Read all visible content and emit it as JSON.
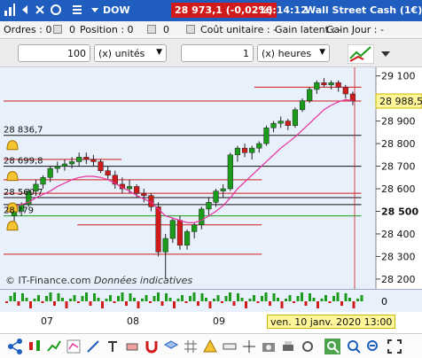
{
  "titlebar": {
    "instrument": "DOW",
    "price_change": "28 973,1 (-0,02%)",
    "time": "16:14:12",
    "market": "Wall Street Cash (1€)"
  },
  "orders": {
    "orders_label": "Ordres : 0",
    "orders_count": "0",
    "position_label": "Position : 0",
    "position_count": "0",
    "unit_cost_label": "Coût unitaire : -",
    "latent_gain_label": "Gain latent : -",
    "day_gain_label": "Gain Jour : -"
  },
  "inputs": {
    "quantity": "100",
    "quantity_unit": "(x) unités",
    "period": "1",
    "period_unit": "(x) heures"
  },
  "chart_data": {
    "type": "candlestick",
    "y_ticks": [
      "29 100",
      "29 000",
      "28 900",
      "28 800",
      "28 700",
      "28 600",
      "28 500",
      "28 400",
      "28 300",
      "28 200"
    ],
    "ylim": [
      28180,
      29130
    ],
    "current_price_label": "28 988,5",
    "bold_tick": "28 500",
    "level_labels": [
      "28 836,7",
      "28 699,8",
      "28 560,7",
      "28 ?79"
    ],
    "x_labels": [
      "07",
      "08",
      "09",
      "10"
    ],
    "cursor_date": "ven. 10 janv. 2020 13:00",
    "watermark": "© IT-Finance.com",
    "watermark_italic": "Données indicatives",
    "colors": {
      "up": "#1a9c1a",
      "down": "#d11a1a",
      "ma": "#e6309c",
      "bg": "#e8f0fb"
    },
    "candles": [
      [
        28480,
        28510,
        28450,
        28500
      ],
      [
        28500,
        28540,
        28480,
        28530
      ],
      [
        28530,
        28600,
        28520,
        28590
      ],
      [
        28590,
        28640,
        28570,
        28620
      ],
      [
        28620,
        28660,
        28600,
        28650
      ],
      [
        28650,
        28700,
        28630,
        28690
      ],
      [
        28690,
        28720,
        28670,
        28700
      ],
      [
        28700,
        28730,
        28680,
        28710
      ],
      [
        28710,
        28740,
        28690,
        28720
      ],
      [
        28720,
        28760,
        28700,
        28740
      ],
      [
        28740,
        28760,
        28710,
        28730
      ],
      [
        28730,
        28750,
        28700,
        28720
      ],
      [
        28720,
        28730,
        28670,
        28680
      ],
      [
        28680,
        28700,
        28640,
        28660
      ],
      [
        28660,
        28680,
        28600,
        28620
      ],
      [
        28620,
        28650,
        28580,
        28600
      ],
      [
        28600,
        28640,
        28580,
        28610
      ],
      [
        28610,
        28620,
        28560,
        28580
      ],
      [
        28580,
        28600,
        28540,
        28570
      ],
      [
        28570,
        28580,
        28500,
        28520
      ],
      [
        28520,
        28540,
        28300,
        28320
      ],
      [
        28320,
        28400,
        28200,
        28380
      ],
      [
        28380,
        28470,
        28360,
        28460
      ],
      [
        28460,
        28480,
        28330,
        28350
      ],
      [
        28350,
        28420,
        28330,
        28410
      ],
      [
        28410,
        28450,
        28380,
        28440
      ],
      [
        28440,
        28520,
        28420,
        28510
      ],
      [
        28510,
        28560,
        28480,
        28540
      ],
      [
        28540,
        28600,
        28520,
        28590
      ],
      [
        28590,
        28620,
        28560,
        28600
      ],
      [
        28600,
        28760,
        28590,
        28750
      ],
      [
        28750,
        28790,
        28720,
        28780
      ],
      [
        28780,
        28800,
        28740,
        28760
      ],
      [
        28760,
        28790,
        28730,
        28780
      ],
      [
        28780,
        28810,
        28760,
        28800
      ],
      [
        28800,
        28880,
        28790,
        28870
      ],
      [
        28870,
        28900,
        28850,
        28890
      ],
      [
        28890,
        28920,
        28870,
        28900
      ],
      [
        28900,
        28910,
        28860,
        28880
      ],
      [
        28880,
        28960,
        28870,
        28950
      ],
      [
        28950,
        29000,
        28940,
        28990
      ],
      [
        28990,
        29050,
        28980,
        29040
      ],
      [
        29040,
        29080,
        29020,
        29070
      ],
      [
        29070,
        29090,
        29050,
        29060
      ],
      [
        29060,
        29080,
        29040,
        29070
      ],
      [
        29070,
        29080,
        29030,
        29050
      ],
      [
        29050,
        29060,
        29000,
        29020
      ],
      [
        29020,
        29030,
        28970,
        28988
      ]
    ],
    "ma": [
      28520,
      28530,
      28540,
      28560,
      28575,
      28590,
      28610,
      28625,
      28640,
      28650,
      28655,
      28655,
      28650,
      28640,
      28625,
      28605,
      28590,
      28570,
      28555,
      28540,
      28510,
      28480,
      28470,
      28460,
      28450,
      28450,
      28460,
      28480,
      28500,
      28525,
      28560,
      28600,
      28630,
      28660,
      28690,
      28720,
      28750,
      28780,
      28805,
      28830,
      28860,
      28890,
      28920,
      28950,
      28970,
      28985,
      28995,
      28990
    ],
    "levels": [
      {
        "price": 28836.7,
        "color": "#111111",
        "from": 0.0,
        "to": 0.97
      },
      {
        "price": 28730,
        "color": "#d11a1a",
        "from": 0.0,
        "to": 0.32
      },
      {
        "price": 28699.8,
        "color": "#111111",
        "from": 0.0,
        "to": 0.97
      },
      {
        "price": 28640,
        "color": "#d11a1a",
        "from": 0.0,
        "to": 0.7
      },
      {
        "price": 28580,
        "color": "#d11a1a",
        "from": 0.0,
        "to": 0.97
      },
      {
        "price": 28560.7,
        "color": "#111111",
        "from": 0.0,
        "to": 0.97
      },
      {
        "price": 28530,
        "color": "#111111",
        "from": 0.0,
        "to": 0.97
      },
      {
        "price": 28480,
        "color": "#1a9c1a",
        "from": 0.0,
        "to": 0.97
      },
      {
        "price": 28440,
        "color": "#d11a1a",
        "from": 0.2,
        "to": 0.7
      },
      {
        "price": 28310,
        "color": "#d11a1a",
        "from": 0.0,
        "to": 0.7
      },
      {
        "price": 29050,
        "color": "#d11a1a",
        "from": 0.68,
        "to": 0.97
      },
      {
        "price": 28988.5,
        "color": "#d11a1a",
        "from": 0.0,
        "to": 0.97
      }
    ]
  },
  "icons": [
    "signal-icon",
    "close-icon",
    "arrow-icon",
    "zoom-icon",
    "trend-icon",
    "share-icon",
    "bell-icon"
  ]
}
